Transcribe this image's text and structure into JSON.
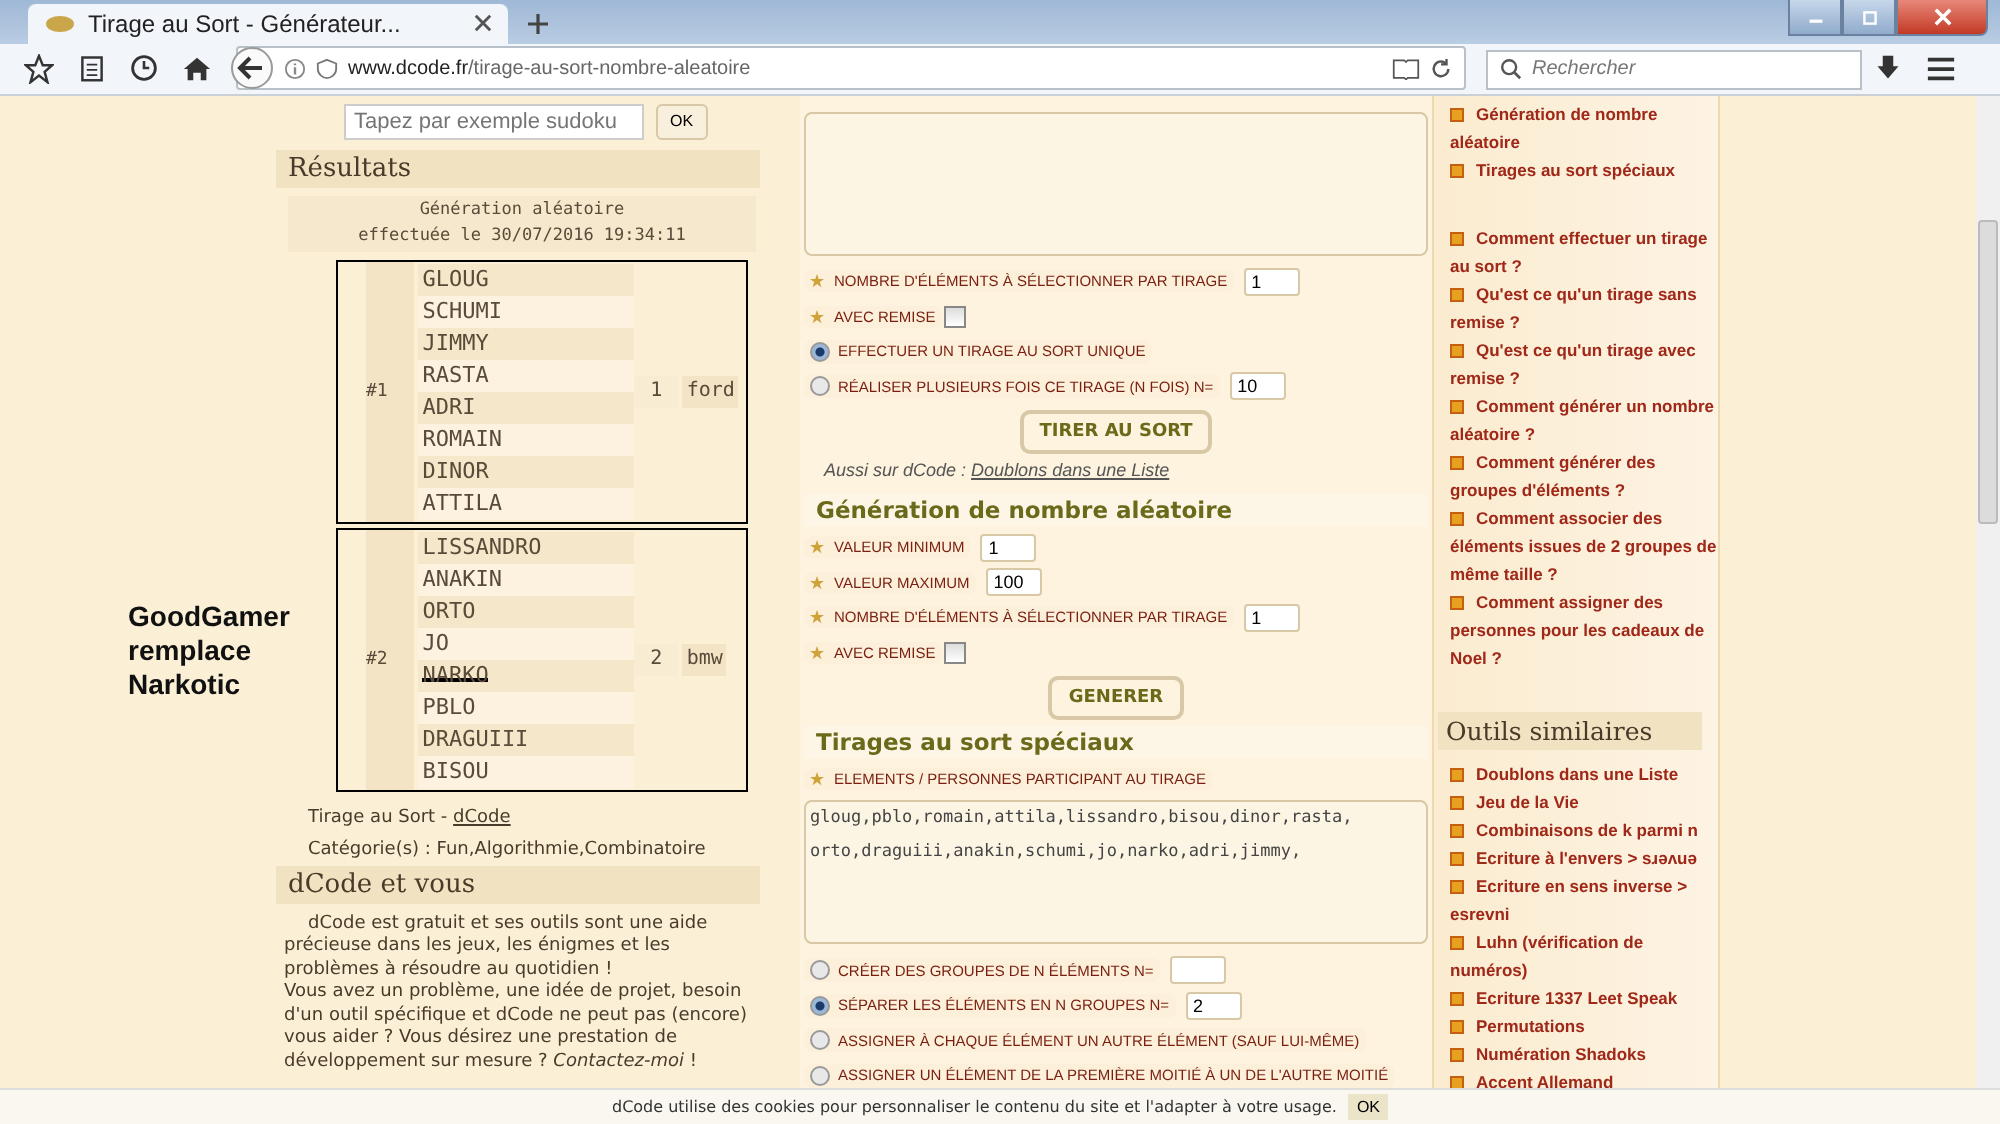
{
  "browser": {
    "tab_title": "Tirage au Sort - Générateur...",
    "url_host": "www.dcode.fr",
    "url_path": "/tirage-au-sort-nombre-aleatoire",
    "search_placeholder": "Rechercher"
  },
  "annotation": "GoodGamer remplace Narkotic",
  "site_search": {
    "placeholder": "Tapez par exemple sudoku",
    "button": "OK"
  },
  "results": {
    "title": "Résultats",
    "header_lines": [
      "Génération aléatoire",
      "effectuée le 30/07/2016 19:34:11"
    ],
    "groups": [
      {
        "label": "#1",
        "number": "1",
        "tag": "ford",
        "members": [
          {
            "name": "GLOUG",
            "struck": false
          },
          {
            "name": "SCHUMI",
            "struck": false
          },
          {
            "name": "JIMMY",
            "struck": false
          },
          {
            "name": "RASTA",
            "struck": false
          },
          {
            "name": "ADRI",
            "struck": false
          },
          {
            "name": "ROMAIN",
            "struck": false
          },
          {
            "name": "DINOR",
            "struck": false
          },
          {
            "name": "ATTILA",
            "struck": false
          }
        ]
      },
      {
        "label": "#2",
        "number": "2",
        "tag": "bmw",
        "members": [
          {
            "name": "LISSANDRO",
            "struck": false
          },
          {
            "name": "ANAKIN",
            "struck": false
          },
          {
            "name": "ORTO",
            "struck": false
          },
          {
            "name": "JO",
            "struck": false
          },
          {
            "name": "NARKO",
            "struck": true
          },
          {
            "name": "PBLO",
            "struck": false
          },
          {
            "name": "DRAGUIII",
            "struck": false
          },
          {
            "name": "BISOU",
            "struck": false
          }
        ]
      }
    ],
    "source_prefix": "Tirage au Sort - ",
    "source_link": "dCode",
    "categories": "Catégorie(s) : Fun,Algorithmie,Combinatoire"
  },
  "about": {
    "title": "dCode et vous",
    "text": "dCode est gratuit et ses outils sont une aide précieuse dans les jeux, les énigmes et les problèmes à résoudre au quotidien !\nVous avez un problème, une idée de projet, besoin d'un outil spécifique et dCode ne peut pas (encore) vous aider ? Vous désirez une prestation de développement sur mesure ? *Contactez-moi* !"
  },
  "draw": {
    "options": [
      {
        "kind": "field",
        "label": "NOMBRE D'ÉLÉMENTS À SÉLECTIONNER PAR TIRAGE",
        "value": "1"
      },
      {
        "kind": "checkbox",
        "label": "AVEC REMISE",
        "checked": false
      },
      {
        "kind": "radio",
        "label": "EFFECTUER UN TIRAGE AU SORT UNIQUE",
        "selected": true
      },
      {
        "kind": "radio-field",
        "label": "RÉALISER PLUSIEURS FOIS CE TIRAGE (N FOIS) N=",
        "selected": false,
        "value": "10"
      }
    ],
    "button": "TIRER AU SORT",
    "also_prefix": "Aussi sur dCode : ",
    "also_link": "Doublons dans une Liste"
  },
  "random_number": {
    "title": "Génération de nombre aléatoire",
    "options": [
      {
        "kind": "field",
        "label": "VALEUR MINIMUM",
        "value": "1"
      },
      {
        "kind": "field",
        "label": "VALEUR MAXIMUM",
        "value": "100"
      },
      {
        "kind": "field",
        "label": "NOMBRE D'ÉLÉMENTS À SÉLECTIONNER PAR TIRAGE",
        "value": "1"
      },
      {
        "kind": "checkbox",
        "label": "AVEC REMISE",
        "checked": false
      }
    ],
    "button": "GENERER"
  },
  "special": {
    "title": "Tirages au sort spéciaux",
    "list_label": "ELEMENTS / PERSONNES PARTICIPANT AU TIRAGE",
    "list_value": "gloug,pblo,romain,attila,lissandro,bisou,dinor,rasta,\norto,draguiii,anakin,schumi,jo,narko,adri,jimmy,",
    "options": [
      {
        "kind": "radio-field",
        "label": "CRÉER DES GROUPES DE N ÉLÉMENTS N=",
        "selected": false
      },
      {
        "kind": "radio-field",
        "label": "SÉPARER LES ÉLÉMENTS EN N GROUPES N=",
        "selected": true,
        "value": "2"
      },
      {
        "kind": "radio",
        "label": "ASSIGNER À CHAQUE ÉLÉMENT UN AUTRE ÉLÉMENT (SAUF LUI-MÊME)",
        "selected": false
      },
      {
        "kind": "radio",
        "label": "ASSIGNER UN ÉLÉMENT DE LA PREMIÈRE MOITIÉ À UN DE L'AUTRE MOITIÉ",
        "selected": false
      }
    ]
  },
  "sidebar": {
    "sections": [
      "Génération de nombre aléatoire",
      "Tirages au sort spéciaux"
    ],
    "faq": [
      "Comment effectuer un tirage au sort ?",
      "Qu'est ce qu'un tirage sans remise ?",
      "Qu'est ce qu'un tirage avec remise ?",
      "Comment générer un nombre aléatoire ?",
      "Comment générer des groupes d'éléments ?",
      "Comment associer des éléments issues de 2 groupes de même taille ?",
      "Comment assigner des personnes pour les cadeaux de Noel ?"
    ],
    "similar_title": "Outils similaires",
    "similar": [
      "Doublons dans une Liste",
      "Jeu de la Vie",
      "Combinaisons de k parmi n",
      "Ecriture à l'envers > sɹǝʌuǝ",
      "Ecriture en sens inverse > esrevni",
      "Luhn (vérification de numéros)",
      "Ecriture 1337 Leet Speak",
      "Permutations",
      "Numération Shadoks",
      "Accent Allemand"
    ]
  },
  "cookie": {
    "text": "dCode utilise des cookies pour personnaliser le contenu du site et l'adapter à votre usage.",
    "button": "OK"
  }
}
